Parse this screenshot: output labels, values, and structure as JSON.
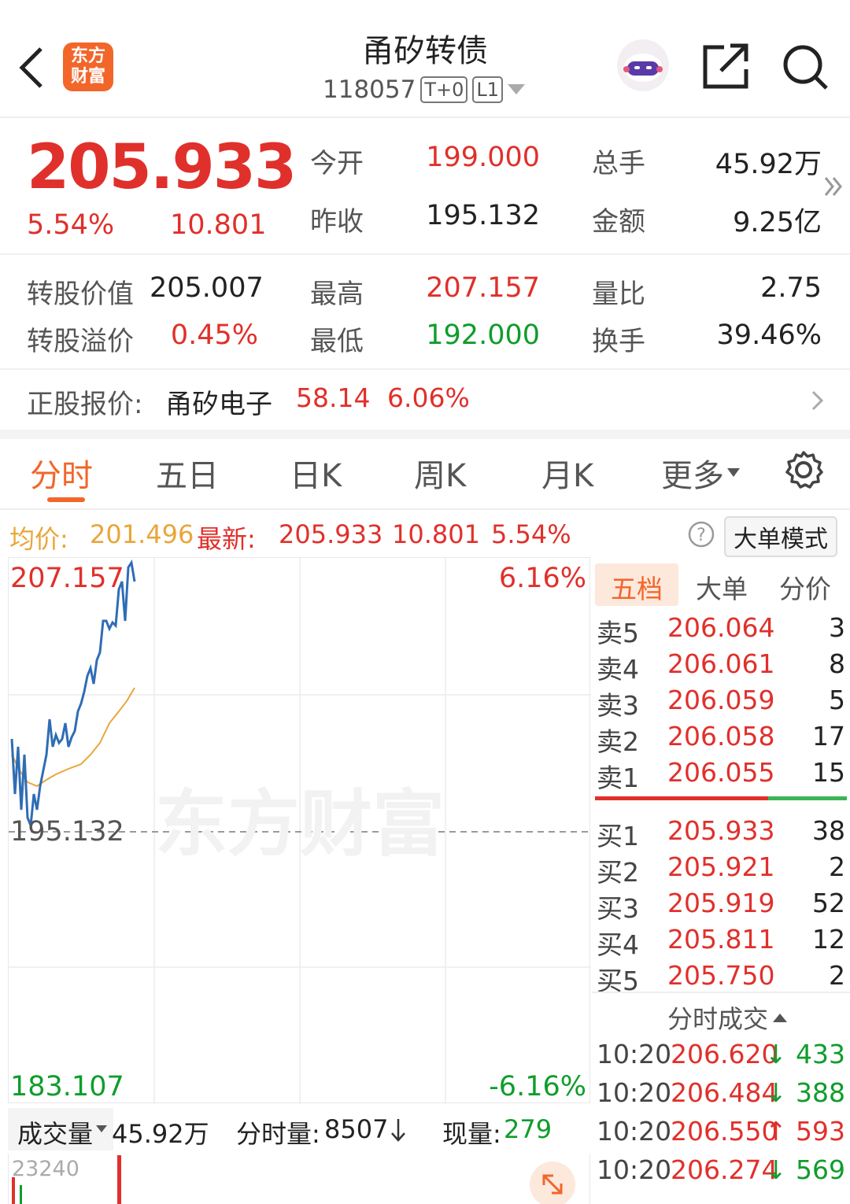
{
  "header": {
    "title": "甬矽转债",
    "code": "118057",
    "tags": [
      "T+0",
      "L1"
    ],
    "logo_text": "东方财富",
    "back_icon": "chevron-left-icon",
    "robot_icon": "robot-avatar-icon",
    "share_icon": "share-icon",
    "search_icon": "search-icon"
  },
  "quote": {
    "price": "205.933",
    "change_pct": "5.54%",
    "change": "10.801",
    "open_label": "今开",
    "open": "199.000",
    "prev_close_label": "昨收",
    "prev_close": "195.132",
    "volume_label": "总手",
    "volume": "45.92万",
    "amount_label": "金额",
    "amount": "9.25亿",
    "conv_value_label": "转股价值",
    "conv_value": "205.007",
    "conv_premium_label": "转股溢价",
    "conv_premium": "0.45%",
    "high_label": "最高",
    "high": "207.157",
    "low_label": "最低",
    "low": "192.000",
    "vol_ratio_label": "量比",
    "vol_ratio": "2.75",
    "turnover_label": "换手",
    "turnover": "39.46%"
  },
  "underlying": {
    "label": "正股报价:",
    "name": "甬矽电子",
    "price": "58.14",
    "change_pct": "6.06%"
  },
  "tabs": [
    "分时",
    "五日",
    "日K",
    "周K",
    "月K",
    "更多"
  ],
  "active_tab": "分时",
  "info_bar": {
    "avg_label": "均价:",
    "avg": "201.496",
    "latest_label": "最新:",
    "latest": "205.933",
    "change": "10.801",
    "change_pct": "5.54%",
    "mode_button": "大单模式"
  },
  "chart": {
    "top_price": "207.157",
    "top_pct": "6.16%",
    "mid_price": "195.132",
    "bottom_price": "183.107",
    "bottom_pct": "-6.16%",
    "watermark": "东方财富"
  },
  "volume_bar": {
    "label": "成交量",
    "total": "45.92万",
    "fs_label": "分时量:",
    "fs_value": "8507",
    "now_label": "现量:",
    "now_value": "279",
    "axis_max": "23240"
  },
  "orderbook": {
    "tabs": [
      "五档",
      "大单",
      "分价"
    ],
    "sells": [
      {
        "label": "卖5",
        "price": "206.064",
        "qty": "3"
      },
      {
        "label": "卖4",
        "price": "206.061",
        "qty": "8"
      },
      {
        "label": "卖3",
        "price": "206.059",
        "qty": "5"
      },
      {
        "label": "卖2",
        "price": "206.058",
        "qty": "17"
      },
      {
        "label": "卖1",
        "price": "206.055",
        "qty": "15"
      }
    ],
    "buys": [
      {
        "label": "买1",
        "price": "205.933",
        "qty": "38"
      },
      {
        "label": "买2",
        "price": "205.921",
        "qty": "2"
      },
      {
        "label": "买3",
        "price": "205.919",
        "qty": "52"
      },
      {
        "label": "买4",
        "price": "205.811",
        "qty": "12"
      },
      {
        "label": "买5",
        "price": "205.750",
        "qty": "2"
      }
    ],
    "ticks_label": "分时成交",
    "ticks": [
      {
        "time": "10:20",
        "price": "206.620",
        "dir": "↓",
        "qty": "433"
      },
      {
        "time": "10:20",
        "price": "206.484",
        "dir": "↓",
        "qty": "388"
      },
      {
        "time": "10:20",
        "price": "206.550",
        "dir": "↑",
        "qty": "593"
      },
      {
        "time": "10:20",
        "price": "206.274",
        "dir": "↓",
        "qty": "569"
      }
    ]
  },
  "colors": {
    "up": "#e0302b",
    "down": "#0f9d2c",
    "accent": "#f2662a",
    "price_line": "#2f6db5",
    "avg_line": "#e9a63a"
  }
}
